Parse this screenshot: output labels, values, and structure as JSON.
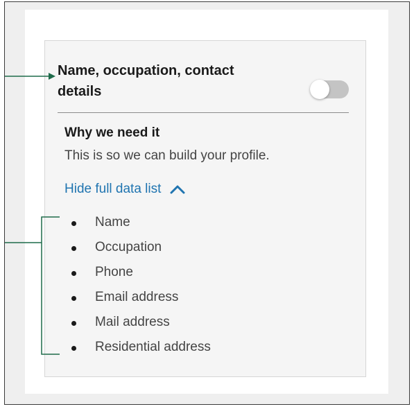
{
  "consent_card": {
    "title": "Name, occupation, contact details",
    "toggle_state": "off",
    "why_heading": "Why we need it",
    "why_text": "This is so we can build your profile.",
    "list_toggle_label": "Hide full data list",
    "list_toggle_icon": "chevron-up-icon",
    "data_items": [
      "Name",
      "Occupation",
      "Phone",
      "Email address",
      "Mail address",
      "Residential address"
    ]
  },
  "colors": {
    "link": "#1f74b0",
    "annotation": "#1e6b4a",
    "toggle_off": "#c4c4c4",
    "card_background": "#f5f5f5"
  }
}
